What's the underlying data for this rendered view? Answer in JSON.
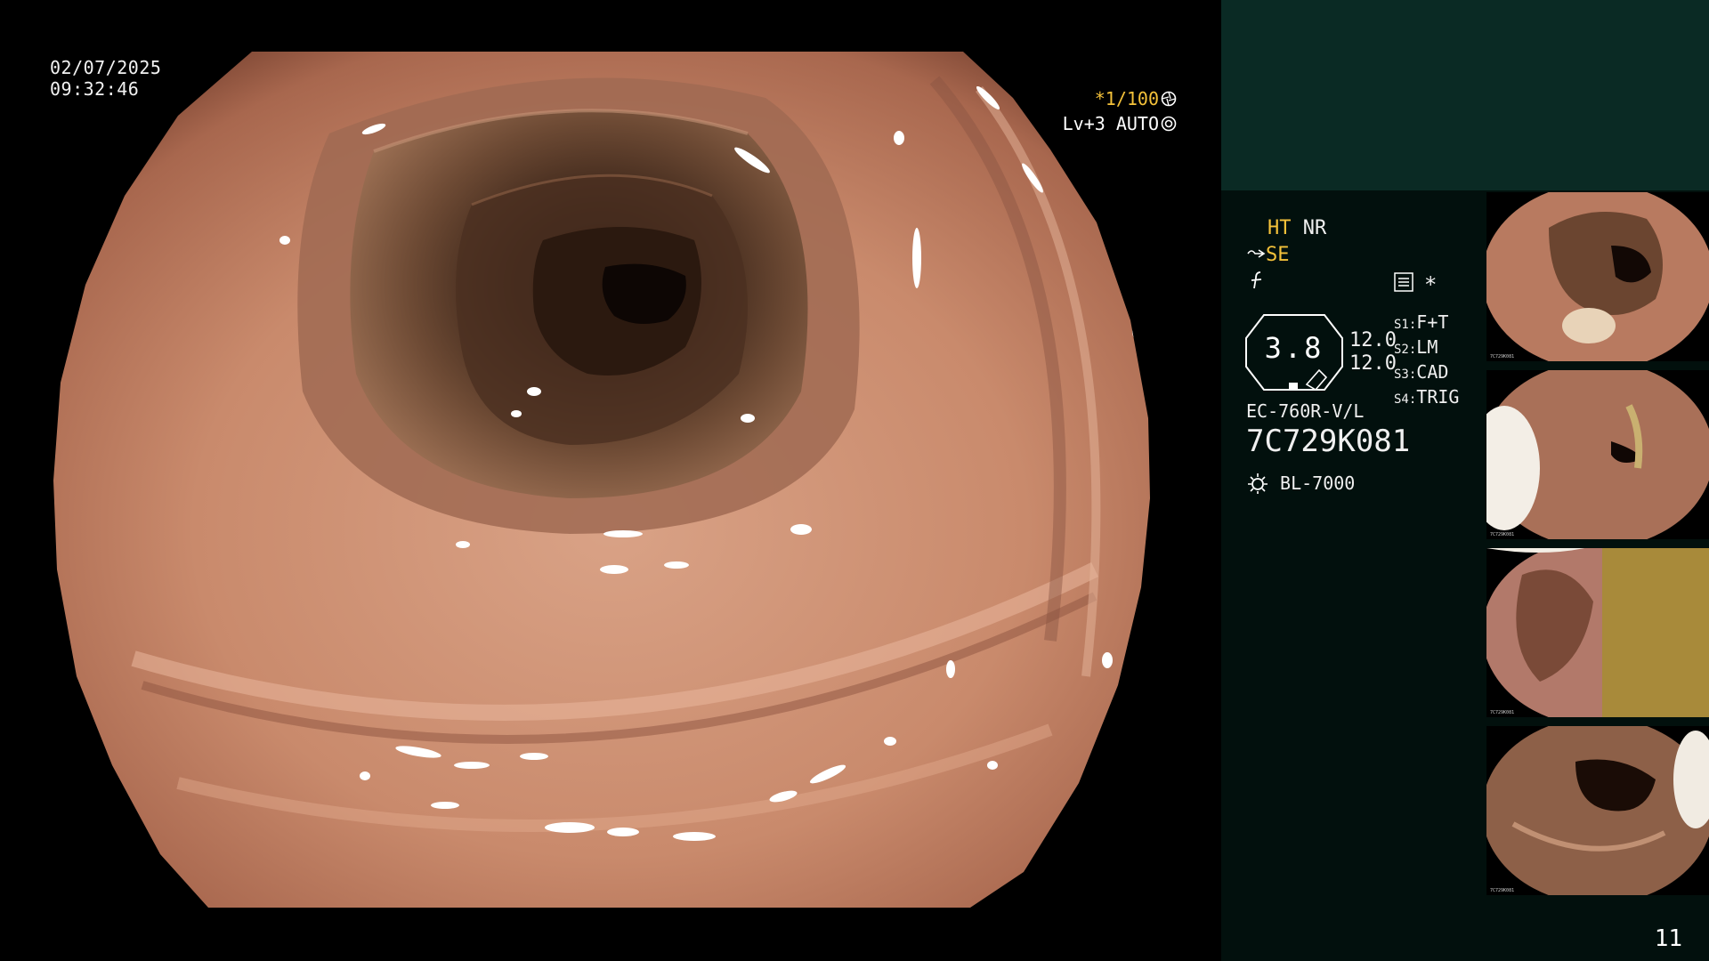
{
  "datetime": {
    "date": "02/07/2025",
    "time": "09:32:46"
  },
  "overlay": {
    "shutter": "*1/100",
    "shutter_icon": "aperture-icon",
    "level": "Lv+3",
    "mode": "AUTO",
    "mode_icon": "iris-icon"
  },
  "settings": {
    "ht": "HT",
    "nr": "NR",
    "se": "SE",
    "se_icon": "scope-angle-icon",
    "fn_icon": "function-f-icon",
    "record_icon": "record-list-icon",
    "asterisk": "*"
  },
  "gauge": {
    "value": "3.8",
    "upper": "12.0",
    "lower": "12.0"
  },
  "switches": [
    {
      "key": "S1",
      "value": "F+T"
    },
    {
      "key": "S2",
      "value": "LM"
    },
    {
      "key": "S3",
      "value": "CAD"
    },
    {
      "key": "S4",
      "value": "TRIG"
    }
  ],
  "scope": {
    "model": "EC-760R-V/L",
    "serial": "7C729K081"
  },
  "light": {
    "icon": "light-source-icon",
    "model": "BL-7000"
  },
  "thumbnails": [
    {
      "name": "capture-1",
      "serial": "7C729K081"
    },
    {
      "name": "capture-2",
      "serial": "7C729K081"
    },
    {
      "name": "capture-3",
      "serial": "7C729K081"
    },
    {
      "name": "capture-4",
      "serial": "7C729K081"
    }
  ],
  "image_count": "11",
  "colors": {
    "panel_bg": "#02100d",
    "panel_top": "#0a2a24",
    "accent_yellow": "#f5c23a",
    "tissue": "#c98a6c"
  }
}
